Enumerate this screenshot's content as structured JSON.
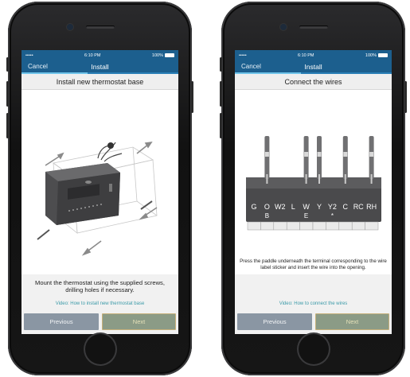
{
  "status": {
    "carrier": "•••••",
    "time": "6:10 PM",
    "battery": "100%"
  },
  "screens": [
    {
      "nav": {
        "cancel": "Cancel",
        "title": "Install"
      },
      "progress": 0.42,
      "heading": "Install new thermostat base",
      "instruction": "Mount the thermostat using the supplied screws, drilling holes if necessary.",
      "video_link": "Video: How to install new thermostat base",
      "buttons": {
        "previous": "Previous",
        "next": "Next"
      }
    },
    {
      "nav": {
        "cancel": "Cancel",
        "title": "Install"
      },
      "progress": 0.42,
      "heading": "Connect the wires",
      "instruction": "Press the paddle underneath the terminal corresponding to the wire label sticker and insert the wire into the opening.",
      "video_link": "Video: How to connect the wires",
      "buttons": {
        "previous": "Previous",
        "next": "Next"
      },
      "terminals": [
        {
          "top": "G",
          "bottom": ""
        },
        {
          "top": "O",
          "bottom": "B"
        },
        {
          "top": "W2",
          "bottom": ""
        },
        {
          "top": "L",
          "bottom": ""
        },
        {
          "top": "W",
          "bottom": "E"
        },
        {
          "top": "Y",
          "bottom": ""
        },
        {
          "top": "Y2",
          "bottom": "*"
        },
        {
          "top": "C",
          "bottom": ""
        },
        {
          "top": "RC",
          "bottom": ""
        },
        {
          "top": "RH",
          "bottom": ""
        }
      ]
    }
  ]
}
